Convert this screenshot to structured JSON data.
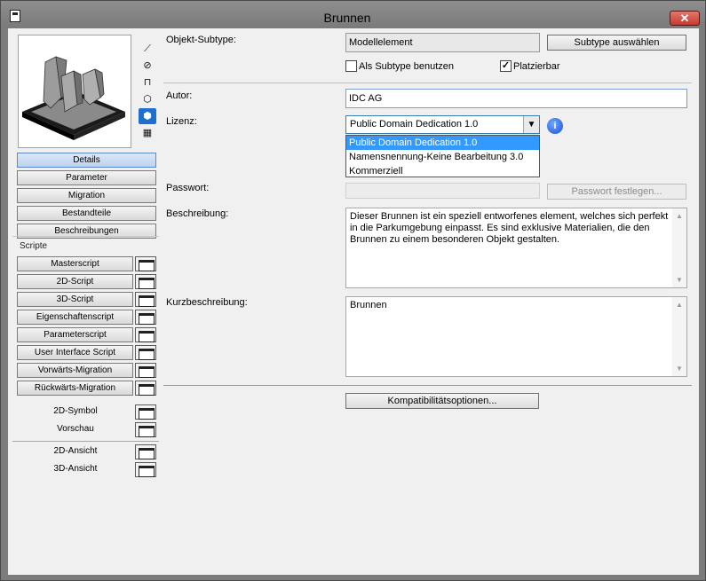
{
  "window": {
    "title": "Brunnen",
    "close_label": "✕"
  },
  "left": {
    "view_icons": [
      "axonometry-icon",
      "plan-icon",
      "elevation-icon",
      "cube-icon",
      "cube-solid-icon",
      "film-icon"
    ],
    "nav": [
      {
        "label": "Details",
        "selected": true
      },
      {
        "label": "Parameter",
        "selected": false
      },
      {
        "label": "Migration",
        "selected": false
      },
      {
        "label": "Bestandteile",
        "selected": false
      },
      {
        "label": "Beschreibungen",
        "selected": false
      }
    ],
    "scripts_heading": "Scripte",
    "scripts": [
      "Masterscript",
      "2D-Script",
      "3D-Script",
      "Eigenschaftenscript",
      "Parameterscript",
      "User Interface Script",
      "Vorwärts-Migration",
      "Rückwärts-Migration"
    ],
    "extras": [
      "2D-Symbol",
      "Vorschau",
      "2D-Ansicht",
      "3D-Ansicht"
    ]
  },
  "form": {
    "subtype_label": "Objekt-Subtype:",
    "subtype_value": "Modellelement",
    "subtype_button": "Subtype auswählen",
    "as_subtype_label": "Als Subtype benutzen",
    "as_subtype_checked": false,
    "placeable_label": "Platzierbar",
    "placeable_checked": true,
    "author_label": "Autor:",
    "author_value": "IDC AG",
    "license_label": "Lizenz:",
    "license_value": "Public Domain Dedication 1.0",
    "license_options": [
      "Public Domain Dedication 1.0",
      "Namensnennung-Keine Bearbeitung 3.0",
      "Kommerziell"
    ],
    "password_label": "Passwort:",
    "password_button": "Passwort festlegen...",
    "description_label": "Beschreibung:",
    "description_value": "Dieser Brunnen ist ein speziell entworfenes element, welches sich perfekt in die Parkumgebung einpasst. Es sind exklusive Materialien, die den Brunnen zu einem besonderen Objekt gestalten.",
    "short_description_label": "Kurzbeschreibung:",
    "short_description_value": "Brunnen",
    "compat_button": "Kompatibilitätsoptionen..."
  }
}
